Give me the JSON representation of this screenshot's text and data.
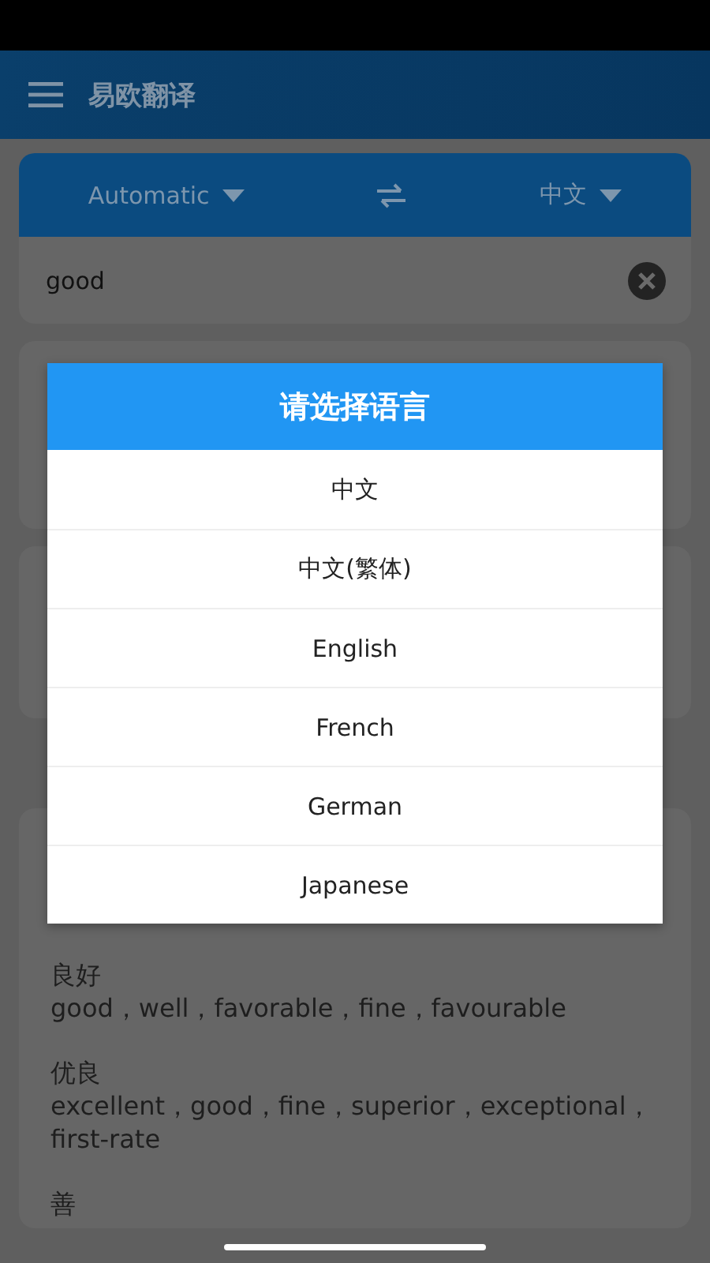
{
  "app_bar": {
    "title": "易欧翻译"
  },
  "language_bar": {
    "source": "Automatic",
    "target": "中文"
  },
  "input": {
    "value": "good"
  },
  "dictionary": {
    "entries": [
      {
        "term": "良好",
        "meanings": "good，well，favorable，fine，favourable"
      },
      {
        "term": "优良",
        "meanings": "excellent，good，fine，superior，exceptional，first-rate"
      },
      {
        "term": "善"
      }
    ]
  },
  "dialog": {
    "title": "请选择语言",
    "options": [
      {
        "label": "中文"
      },
      {
        "label": "中文(繁体)"
      },
      {
        "label": "English"
      },
      {
        "label": "French"
      },
      {
        "label": "German"
      },
      {
        "label": "Japanese"
      }
    ]
  }
}
